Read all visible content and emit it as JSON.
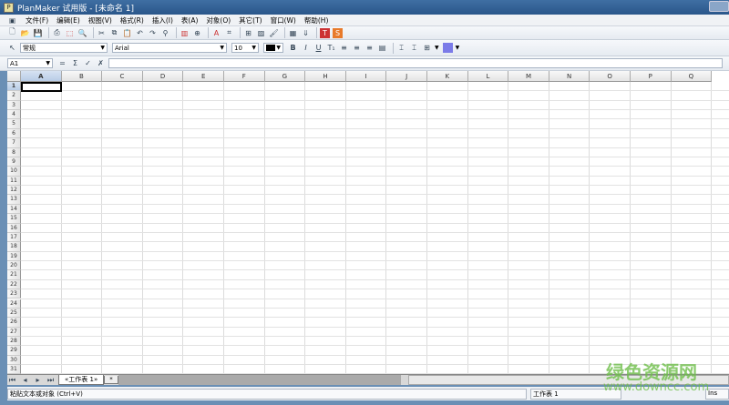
{
  "title": "PlanMaker 试用版 - [未命名 1]",
  "menu": [
    "文件(F)",
    "编辑(E)",
    "视图(V)",
    "格式(R)",
    "插入(I)",
    "表(A)",
    "对象(O)",
    "其它(T)",
    "窗口(W)",
    "帮助(H)"
  ],
  "format": {
    "style": "常规",
    "font": "Arial",
    "size": "10"
  },
  "formula": {
    "cell_ref": "A1",
    "value": ""
  },
  "columns": [
    "A",
    "B",
    "C",
    "D",
    "E",
    "F",
    "G",
    "H",
    "I",
    "J",
    "K",
    "L",
    "M",
    "N",
    "O",
    "P",
    "Q"
  ],
  "row_count": 31,
  "tabs": {
    "active": "«工作表 1»",
    "add": "*"
  },
  "status": {
    "message": "粘贴文本或对象 (Ctrl+V)",
    "sheet": "工作表 1",
    "mode": "Ins"
  },
  "watermark": {
    "name": "绿色资源网",
    "url": "www.downcc.com"
  },
  "colors": {
    "fill": "#7b7be8",
    "titlebar": "#2a568a"
  }
}
